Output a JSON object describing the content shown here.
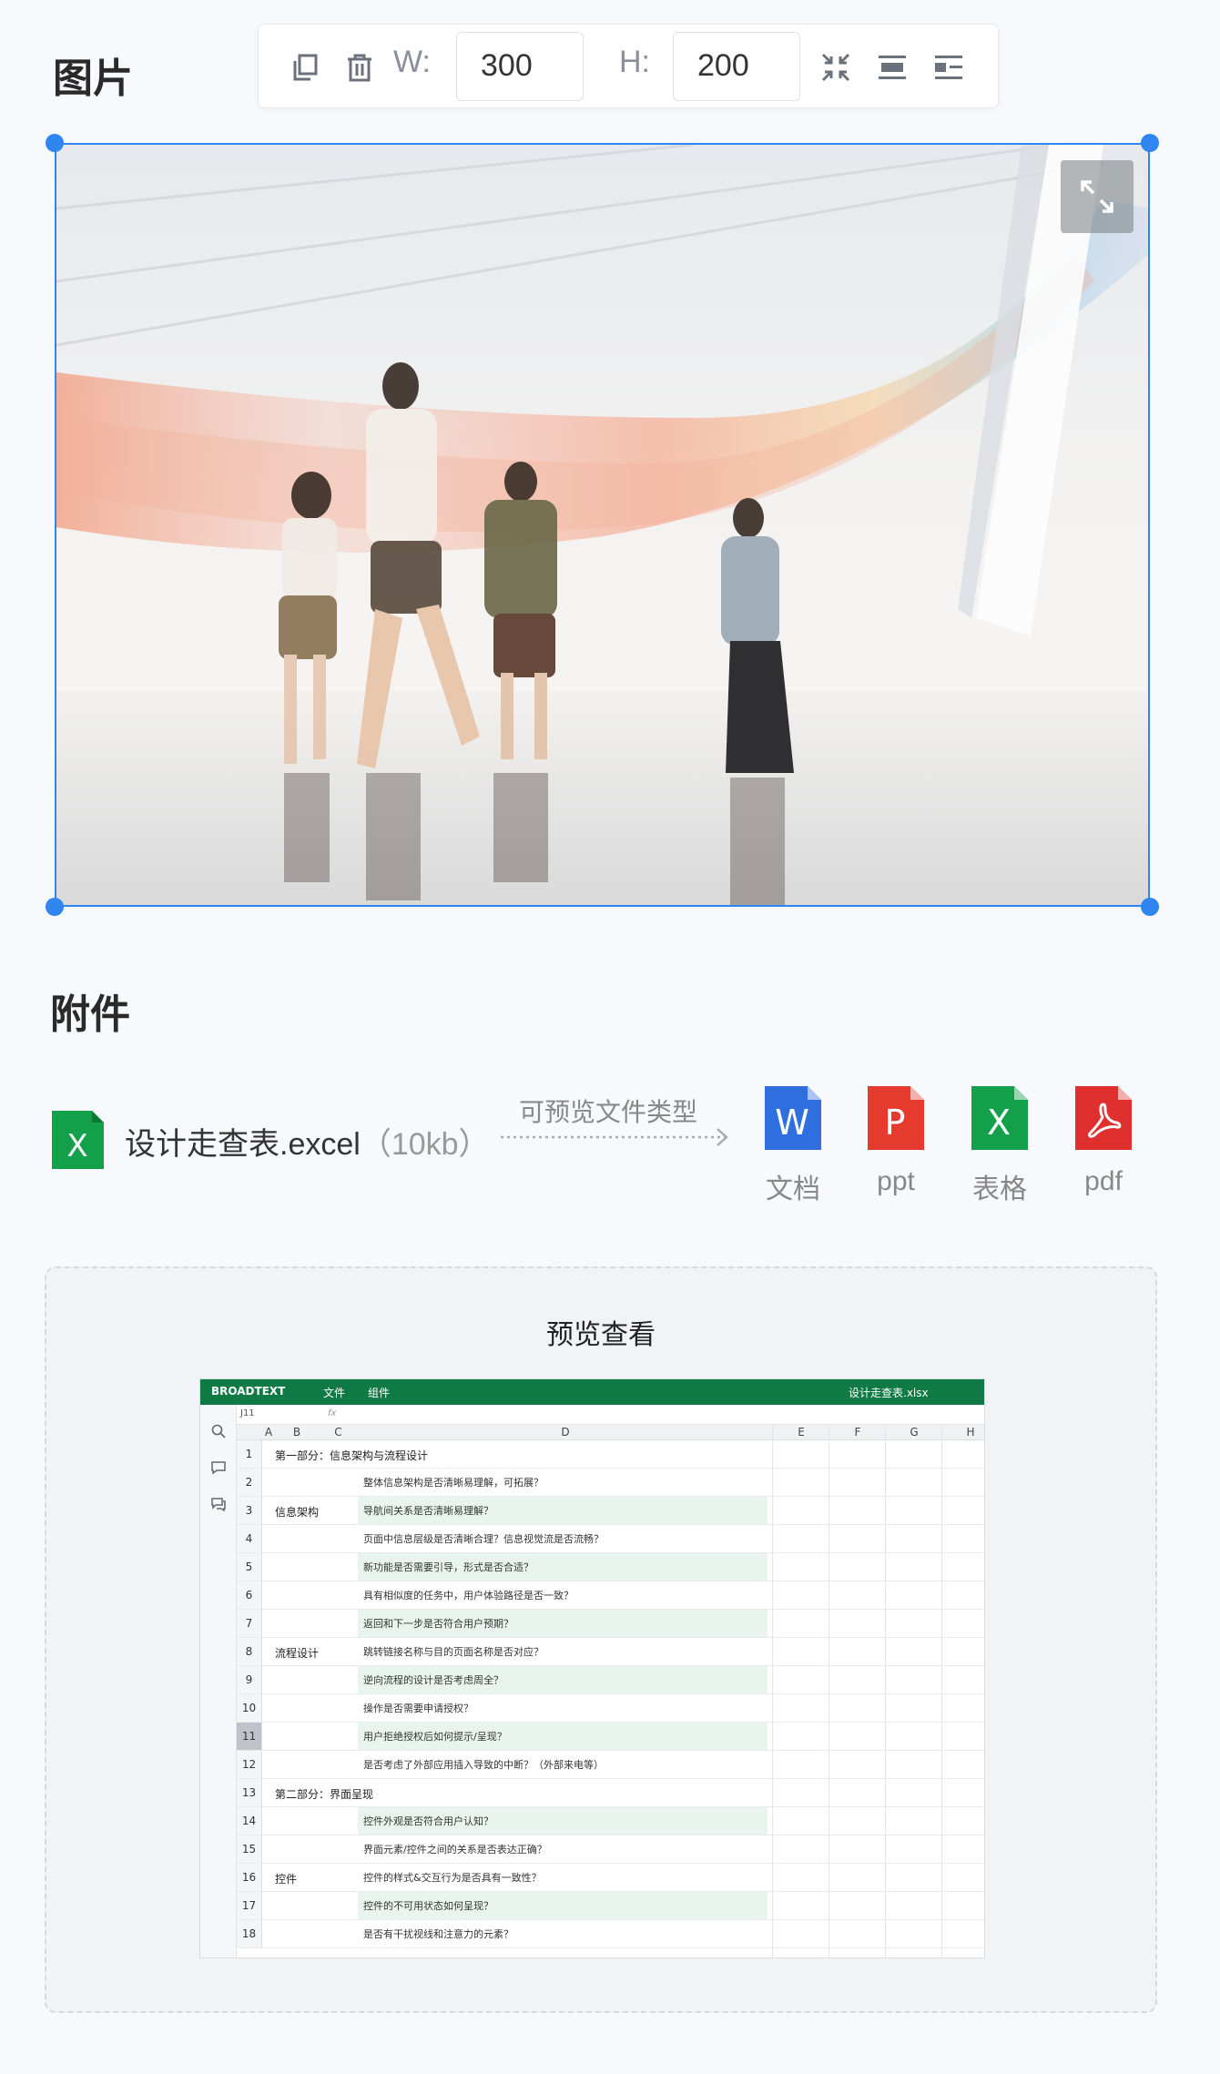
{
  "image_section": {
    "title": "图片",
    "toolbar": {
      "width_label": "W:",
      "width_value": "300",
      "height_label": "H:",
      "height_value": "200",
      "icons": [
        "copy-icon",
        "delete-icon",
        "compress-icon",
        "align-center-icon",
        "align-left-text-icon"
      ]
    },
    "expand_icon": "expand-icon",
    "accent_color": "#2f86f0"
  },
  "attachment_section": {
    "title": "附件",
    "file": {
      "name": "设计走查表.excel",
      "size": "（10kb）",
      "icon": "excel-icon"
    },
    "preview_types_label": "可预览文件类型",
    "types": [
      {
        "label": "文档",
        "letter": "W",
        "color": "#2f6fe0"
      },
      {
        "label": "ppt",
        "letter": "P",
        "color": "#e63a2e"
      },
      {
        "label": "表格",
        "letter": "X",
        "color": "#14a04a"
      },
      {
        "label": "pdf",
        "letter": "pdf",
        "color": "#e02f2f"
      }
    ]
  },
  "preview": {
    "title": "预览查看",
    "sheet": {
      "brand": "BROADTEXT",
      "menu": [
        "文件",
        "组件"
      ],
      "filename": "设计走查表.xlsx",
      "cell_ref": "J11",
      "fx": "fx",
      "columns": [
        "A",
        "B",
        "C",
        "D",
        "E",
        "F",
        "G",
        "H"
      ],
      "rows": [
        {
          "num": "1",
          "b": "第一部分：信息架构与流程设计",
          "d": ""
        },
        {
          "num": "2",
          "b": "",
          "d": "整体信息架构是否清晰易理解，可拓展？"
        },
        {
          "num": "3",
          "b": "信息架构",
          "d": "导航间关系是否清晰易理解？"
        },
        {
          "num": "4",
          "b": "",
          "d": "页面中信息层级是否清晰合理？信息视觉流是否流畅？"
        },
        {
          "num": "5",
          "b": "",
          "d": "新功能是否需要引导，形式是否合适？"
        },
        {
          "num": "6",
          "b": "",
          "d": "具有相似度的任务中，用户体验路径是否一致？"
        },
        {
          "num": "7",
          "b": "",
          "d": "返回和下一步是否符合用户预期？"
        },
        {
          "num": "8",
          "b": "流程设计",
          "d": "跳转链接名称与目的页面名称是否对应？"
        },
        {
          "num": "9",
          "b": "",
          "d": "逆向流程的设计是否考虑周全？"
        },
        {
          "num": "10",
          "b": "",
          "d": "操作是否需要申请授权？"
        },
        {
          "num": "11",
          "b": "",
          "d": "用户拒绝授权后如何提示/呈现？"
        },
        {
          "num": "12",
          "b": "",
          "d": "是否考虑了外部应用插入导致的中断？（外部来电等）"
        },
        {
          "num": "13",
          "b": "第二部分：界面呈现",
          "d": ""
        },
        {
          "num": "14",
          "b": "",
          "d": "控件外观是否符合用户认知？"
        },
        {
          "num": "15",
          "b": "",
          "d": "界面元素/控件之间的关系是否表达正确？"
        },
        {
          "num": "16",
          "b": "控件",
          "d": "控件的样式&交互行为是否具有一致性？"
        },
        {
          "num": "17",
          "b": "",
          "d": "控件的不可用状态如何呈现？"
        },
        {
          "num": "18",
          "b": "",
          "d": "是否有干扰视线和注意力的元素？"
        }
      ]
    }
  }
}
